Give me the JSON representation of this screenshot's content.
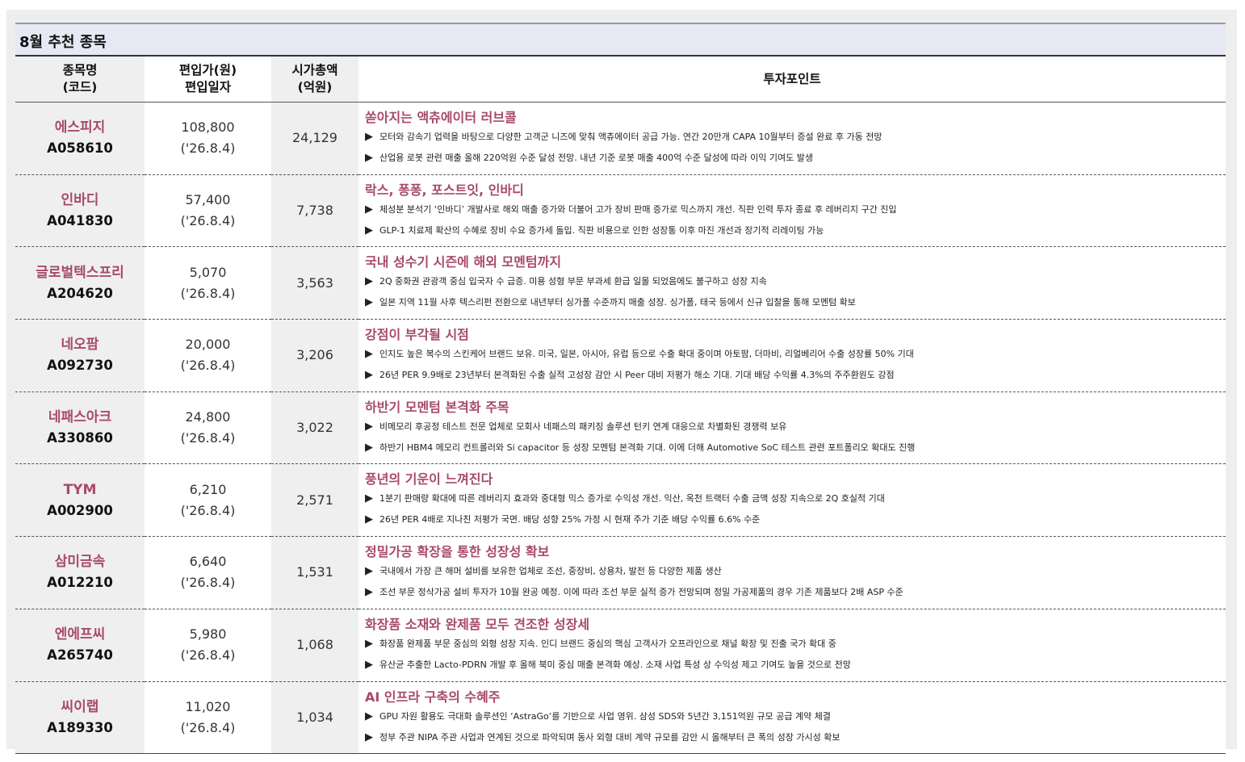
{
  "table_title": "8월 추천 종목",
  "headers": {
    "name_line1": "종목명",
    "name_line2": "(코드)",
    "price_line1": "편입가(원)",
    "price_line2": "편입일자",
    "mcap_line1": "시가총액",
    "mcap_line2": "(억원)",
    "point": "투자포인트"
  },
  "rows": [
    {
      "name": "에스피지",
      "code": "A058610",
      "price": "108,800",
      "date": "('26.8.4)",
      "mcap": "24,129",
      "point_title": "쏟아지는 액츄에이터 러브콜",
      "bullets": [
        "모터와 감속기 업력을 바탕으로 다양한 고객군 니즈에 맞춰 액츄에이터 공급 가능. 연간 20만개 CAPA 10월부터 증설 완료 후 가동 전망",
        "산업용 로봇 관련 매출 올해 220억원 수준 달성 전망. 내년 기준 로봇 매출 400억 수준 달성에 따라 이익 기여도 발생"
      ]
    },
    {
      "name": "인바디",
      "code": "A041830",
      "price": "57,400",
      "date": "('26.8.4)",
      "mcap": "7,738",
      "point_title": "락스, 퐁퐁, 포스트잇, 인바디",
      "bullets": [
        "체성분 분석기 ‘인바디’ 개발사로 해외 매출 증가와 더불어 고가 장비 판매 증가로 믹스까지 개선. 직판 인력 투자 종료 후 레버리지 구간 진입",
        "GLP-1 치료제 확산의 수혜로 장비 수요 증가세 돌입. 직판 비용으로 인한 성장통 이후 마진 개선과 장기적 리레이팅 가능"
      ]
    },
    {
      "name": "글로벌텍스프리",
      "code": "A204620",
      "price": "5,070",
      "date": "('26.8.4)",
      "mcap": "3,563",
      "point_title": "국내 성수기 시즌에 해외 모멘텀까지",
      "bullets": [
        "2Q 중화권 관광객 중심 입국자 수 급증. 미용 성형 부문 부과세 환급 일몰 되었음에도 불구하고 성장 지속",
        "일본 지역 11월 사후 텍스리펀 전환으로 내년부터 싱가폴 수준까지 매출 성장. 싱가폴, 태국 등에서 신규 입찰을 통해 모멘텀 확보"
      ]
    },
    {
      "name": "네오팜",
      "code": "A092730",
      "price": "20,000",
      "date": "('26.8.4)",
      "mcap": "3,206",
      "point_title": "강점이 부각될 시점",
      "bullets": [
        "인지도 높은 복수의 스킨케어 브랜드 보유. 미국, 일본, 아시아, 유럽 등으로 수출 확대 중이며 아토팜, 더마비, 리얼베리어 수출 성장률 50% 기대",
        "26년 PER 9.9배로 23년부터 본격화된 수출 실적 고성장 감안 시 Peer 대비 저평가 해소 기대. 기대 배당 수익률 4.3%의 주주환원도 강점"
      ]
    },
    {
      "name": "네패스아크",
      "code": "A330860",
      "price": "24,800",
      "date": "('26.8.4)",
      "mcap": "3,022",
      "point_title": "하반기 모멘텀 본격화 주목",
      "bullets": [
        "비메모리 후공정 테스트 전문 업체로 모회사 네패스의 패키징 솔루션 턴키 연계 대응으로 차별화된 경쟁력 보유",
        "하반기 HBM4 메모리 컨트롤러와 Si capacitor 등 성장 모멘텀 본격화 기대. 이에 더해 Automotive SoC 테스트 관련 포트폴리오 확대도 진행"
      ]
    },
    {
      "name": "TYM",
      "code": "A002900",
      "price": "6,210",
      "date": "('26.8.4)",
      "mcap": "2,571",
      "point_title": "풍년의 기운이 느껴진다",
      "bullets": [
        "1분기 판매량 확대에 따른 레버리지 효과와 중대형 믹스 증가로 수익성 개선. 익산, 옥천 트랙터 수출 금액 성장 지속으로 2Q 호실적 기대",
        "26년 PER 4배로 지나친 저평가 국면. 배당 성향 25% 가정 시 현재 주가 기준 배당 수익률 6.6% 수준"
      ]
    },
    {
      "name": "삼미금속",
      "code": "A012210",
      "price": "6,640",
      "date": "('26.8.4)",
      "mcap": "1,531",
      "point_title": "정밀가공 확장을 통한 성장성 확보",
      "bullets": [
        "국내에서 가장 큰 해머 설비를 보유한 업체로 조선, 중장비, 상용차, 발전 등 다양한 제품 생산",
        "조선 부문 정삭가공 설비 투자가 10월 완공 예정. 이에 따라 조선 부문 실적 증가 전망되며 정밀 가공제품의 경우 기존 제품보다 2배 ASP 수준"
      ]
    },
    {
      "name": "엔에프씨",
      "code": "A265740",
      "price": "5,980",
      "date": "('26.8.4)",
      "mcap": "1,068",
      "point_title": "화장품 소재와 완제품 모두 견조한 성장세",
      "bullets": [
        "화장품 완제품 부문 중심의 외형 성장 지속. 인디 브랜드 중심의 핵심 고객사가 오프라인으로 채널 확장 및 진출 국가 확대 중",
        "유산균 추출한 Lacto-PDRN 개발 후 올해 북미 중심 매출 본격화 예상. 소재 사업 특성 상 수익성 제고 기여도 높을 것으로 전망"
      ]
    },
    {
      "name": "씨이랩",
      "code": "A189330",
      "price": "11,020",
      "date": "('26.8.4)",
      "mcap": "1,034",
      "point_title": "AI 인프라 구축의 수혜주",
      "bullets": [
        "GPU 자원 활용도 극대화 솔루션인 ‘AstraGo’를 기반으로 사업 영위. 삼성 SDS와 5년간 3,151억원 규모 공급 계약 체결",
        "정부 주관 NIPA 주관 사업과 연계된 것으로 파악되며 동사 외형 대비 계약 규모를 감안 시 올해부터 큰 폭의 성장 가시성 확보"
      ]
    }
  ]
}
